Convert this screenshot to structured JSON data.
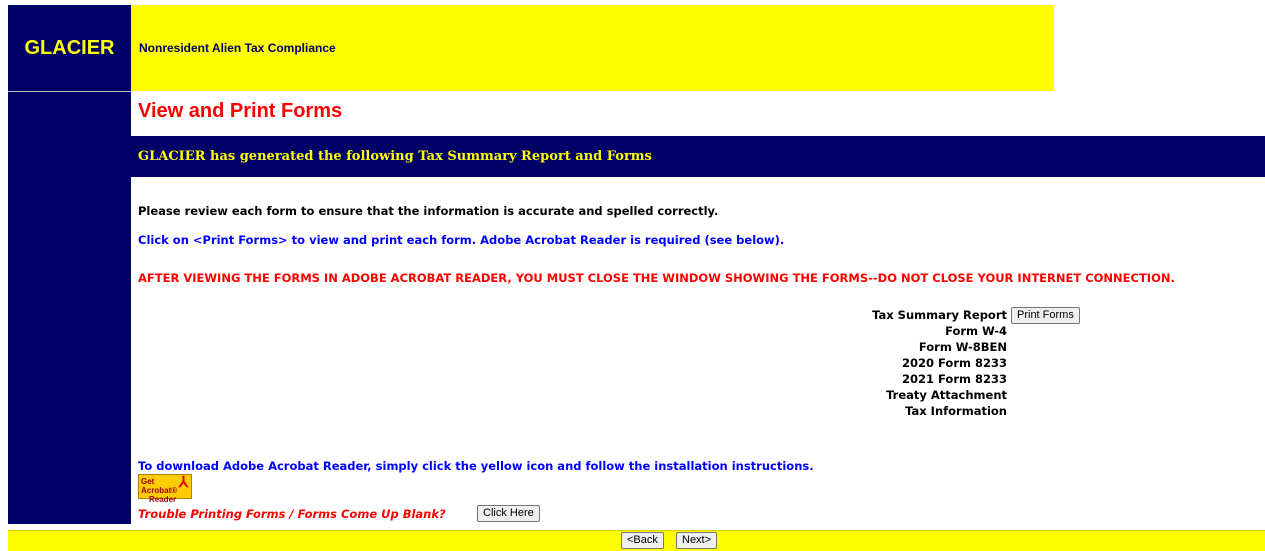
{
  "brand": "GLACIER",
  "header": {
    "subtitle": "Nonresident Alien Tax Compliance"
  },
  "page": {
    "title": "View and Print Forms"
  },
  "banner": "GLACIER has generated the following Tax Summary Report and Forms",
  "instructions": {
    "review": "Please review each form to ensure that the information is accurate and spelled correctly.",
    "print": "Click on <Print Forms> to view and print each form. Adobe Acrobat Reader is required (see below).",
    "warning": "AFTER VIEWING THE FORMS IN ADOBE ACROBAT READER, YOU MUST CLOSE THE WINDOW SHOWING THE FORMS--DO NOT CLOSE YOUR INTERNET CONNECTION."
  },
  "forms": {
    "items": [
      "Tax Summary Report",
      "Form W-4",
      "Form W-8BEN",
      "2020 Form 8233",
      "2021 Form 8233",
      "Treaty Attachment",
      "Tax Information"
    ],
    "print_label": "Print Forms"
  },
  "download": {
    "text": "To download Adobe Acrobat Reader, simply click the yellow icon and follow the installation instructions.",
    "icon_line1": "Get Acrobat®",
    "icon_line2": "Reader"
  },
  "trouble": {
    "text": "Trouble Printing Forms / Forms Come Up Blank?",
    "button": "Click Here"
  },
  "nav": {
    "back": "<Back",
    "next": "Next>"
  },
  "colors": {
    "navy": "#000066",
    "yellow": "#ffff00",
    "red": "#ff0000",
    "blue": "#0000ff"
  }
}
